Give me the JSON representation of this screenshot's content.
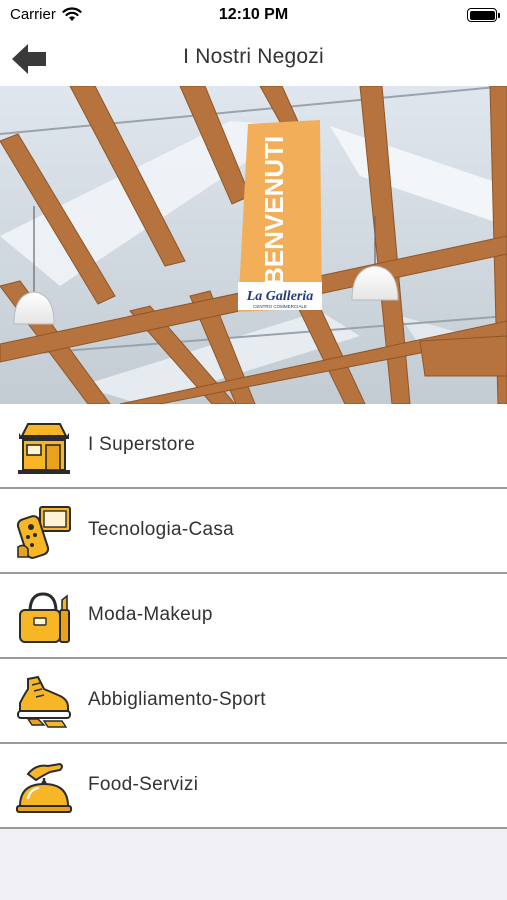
{
  "status_bar": {
    "carrier": "Carrier",
    "time": "12:10 PM",
    "wifi_icon": "wifi-icon",
    "battery_icon": "battery-icon"
  },
  "nav": {
    "title": "I Nostri Negozi",
    "back_icon": "arrow-left-icon"
  },
  "hero": {
    "banner_text": "BENVENUTI",
    "banner_logo": "La Galleria",
    "banner_sub": "CENTRO COMMERCIALE"
  },
  "menu": {
    "items": [
      {
        "label": "I Superstore",
        "icon": "storefront-icon"
      },
      {
        "label": "Tecnologia-Casa",
        "icon": "remote-control-icon"
      },
      {
        "label": "Moda-Makeup",
        "icon": "handbag-icon"
      },
      {
        "label": "Abbigliamento-Sport",
        "icon": "sneaker-icon"
      },
      {
        "label": "Food-Servizi",
        "icon": "serving-cloche-icon"
      }
    ]
  },
  "colors": {
    "icon_orange": "#f6b626",
    "icon_outline": "#2b2b2b",
    "divider": "#9a9a9a",
    "background": "#efeff4"
  }
}
